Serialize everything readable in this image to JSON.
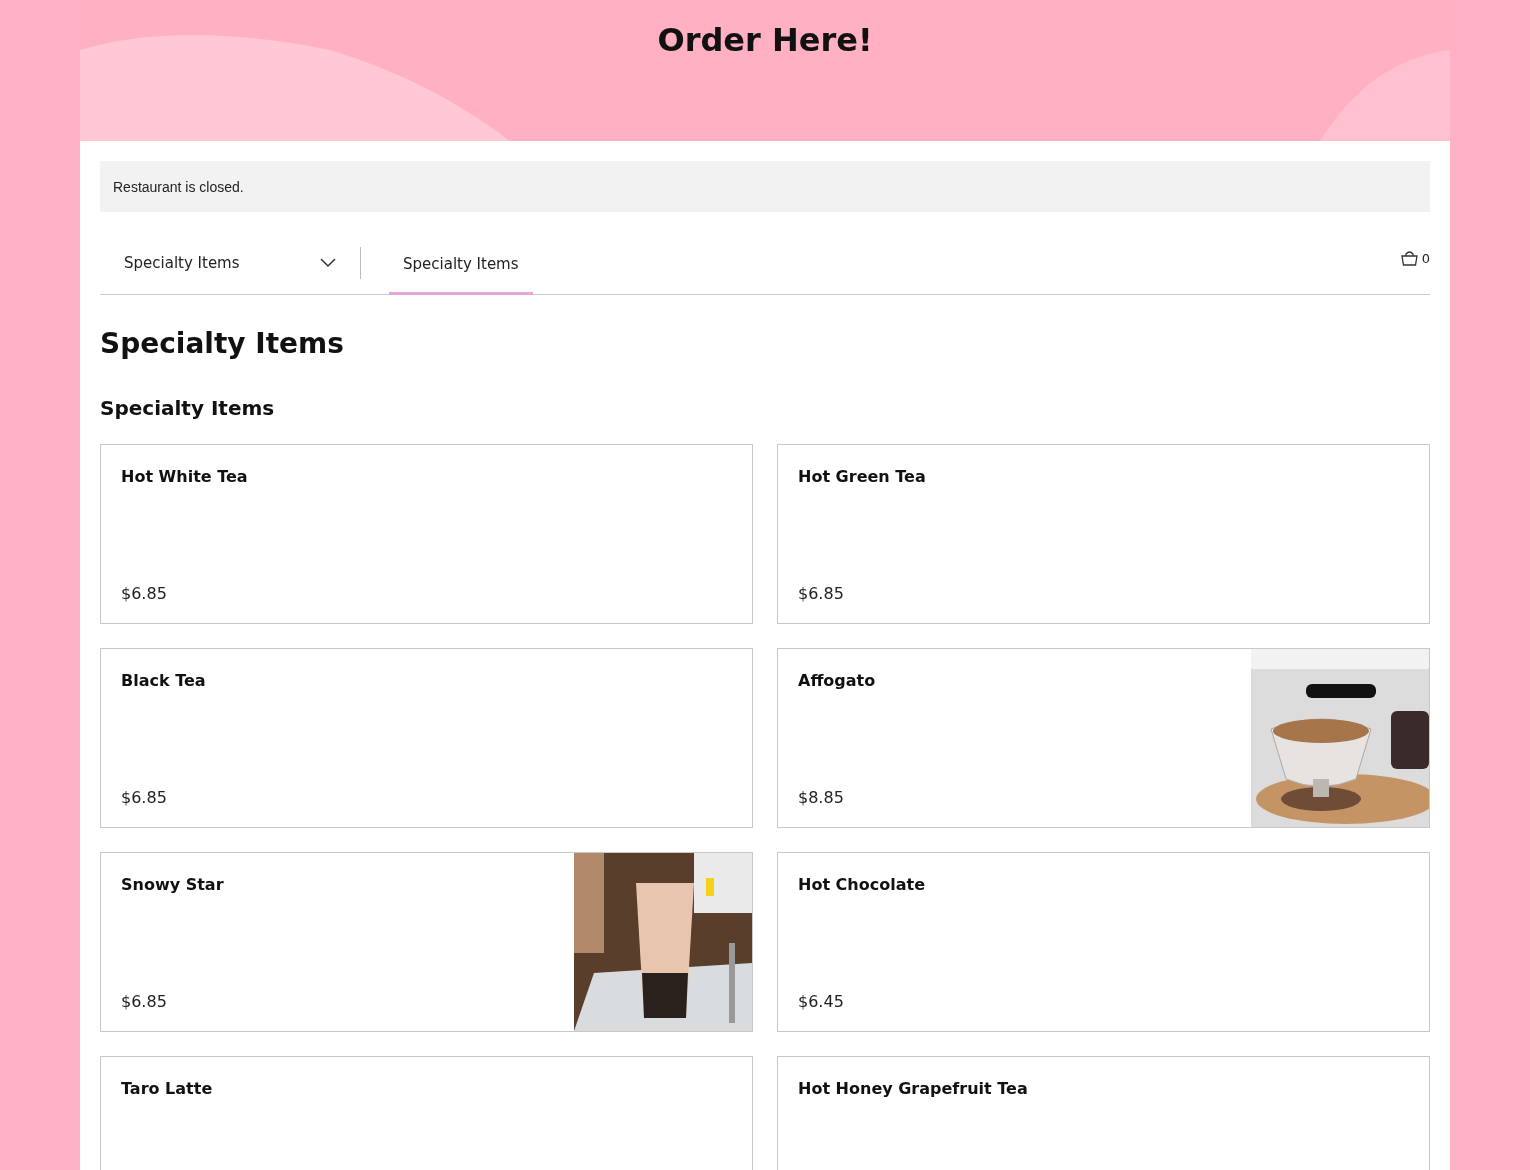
{
  "header": {
    "title": "Order Here!"
  },
  "notice": "Restaurant is closed.",
  "menu_select": {
    "value": "Specialty Items"
  },
  "tabs": [
    {
      "label": "Specialty Items",
      "selected": true
    }
  ],
  "cart": {
    "count": "0"
  },
  "page_heading": "Specialty Items",
  "section_heading": "Specialty Items",
  "items": [
    {
      "name": "Hot White Tea",
      "price": "$6.85"
    },
    {
      "name": "Hot Green Tea",
      "price": "$6.85"
    },
    {
      "name": "Black Tea",
      "price": "$6.85"
    },
    {
      "name": "Affogato",
      "price": "$8.85"
    },
    {
      "name": "Snowy Star",
      "price": "$6.85"
    },
    {
      "name": "Hot Chocolate",
      "price": "$6.45"
    },
    {
      "name": "Taro Latte"
    },
    {
      "name": "Hot Honey Grapefruit Tea"
    }
  ]
}
